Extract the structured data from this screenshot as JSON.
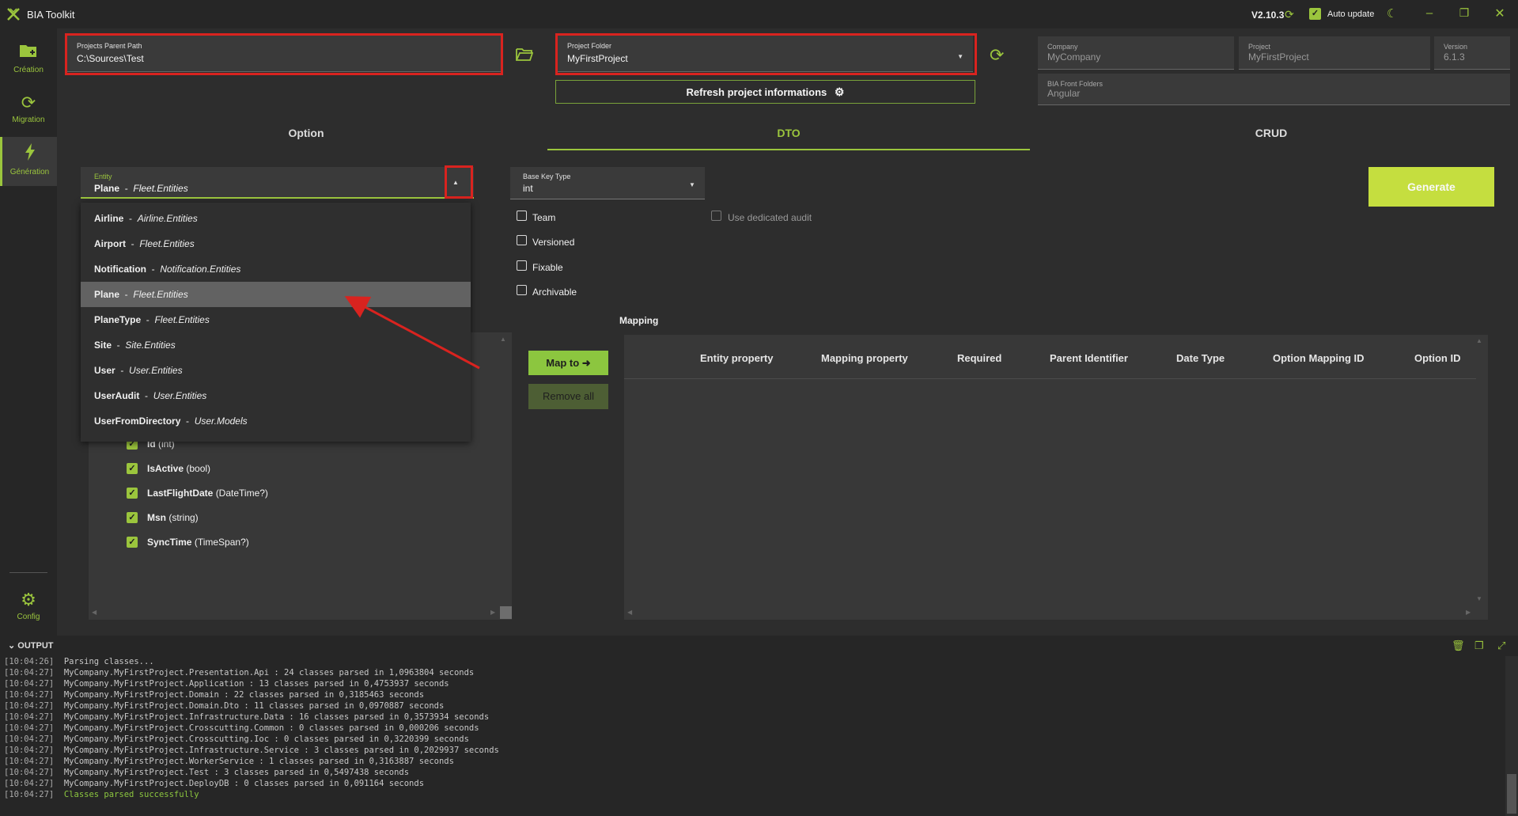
{
  "app": {
    "title": "BIA Toolkit",
    "version": "V2.10.3",
    "auto_update_label": "Auto update"
  },
  "sidebar": {
    "items": [
      {
        "label": "Création",
        "icon": "folder-plus-icon"
      },
      {
        "label": "Migration",
        "icon": "sync-icon"
      },
      {
        "label": "Génération",
        "icon": "lightning-icon"
      }
    ],
    "config_label": "Config"
  },
  "top": {
    "parent_path": {
      "label": "Projects Parent Path",
      "value": "C:\\Sources\\Test"
    },
    "project_folder": {
      "label": "Project Folder",
      "value": "MyFirstProject"
    },
    "refresh_label": "Refresh project informations",
    "company": {
      "label": "Company",
      "value": "MyCompany"
    },
    "project": {
      "label": "Project",
      "value": "MyFirstProject"
    },
    "version": {
      "label": "Version",
      "value": "6.1.3"
    },
    "front_folders": {
      "label": "BIA Front Folders",
      "value": "Angular"
    }
  },
  "tabs": [
    "Option",
    "DTO",
    "CRUD"
  ],
  "active_tab": "DTO",
  "entity": {
    "label": "Entity",
    "selected_name": "Plane",
    "selected_ns": "Fleet.Entities",
    "options": [
      {
        "name": "Airline",
        "ns": "Airline.Entities"
      },
      {
        "name": "Airport",
        "ns": "Fleet.Entities"
      },
      {
        "name": "Notification",
        "ns": "Notification.Entities"
      },
      {
        "name": "Plane",
        "ns": "Fleet.Entities"
      },
      {
        "name": "PlaneType",
        "ns": "Fleet.Entities"
      },
      {
        "name": "Site",
        "ns": "Site.Entities"
      },
      {
        "name": "User",
        "ns": "User.Entities"
      },
      {
        "name": "UserAudit",
        "ns": "User.Entities"
      },
      {
        "name": "UserFromDirectory",
        "ns": "User.Models"
      }
    ],
    "separator": "-"
  },
  "base_key": {
    "label": "Base Key Type",
    "value": "int"
  },
  "options": {
    "team": "Team",
    "versioned": "Versioned",
    "fixable": "Fixable",
    "archivable": "Archivable",
    "dedicated_audit": "Use dedicated audit"
  },
  "generate_label": "Generate",
  "properties": [
    {
      "name": "Id",
      "type": "(int)"
    },
    {
      "name": "IsActive",
      "type": "(bool)"
    },
    {
      "name": "LastFlightDate",
      "type": "(DateTime?)"
    },
    {
      "name": "Msn",
      "type": "(string)"
    },
    {
      "name": "SyncTime",
      "type": "(TimeSpan?)"
    }
  ],
  "map_to_label": "Map to ➜",
  "remove_all_label": "Remove all",
  "mapping": {
    "title": "Mapping",
    "columns": [
      "Entity property",
      "Mapping property",
      "Required",
      "Parent Identifier",
      "Date Type",
      "Option Mapping ID",
      "Option ID"
    ]
  },
  "output": {
    "title": "OUTPUT",
    "lines": [
      {
        "ts": "[10:04:26]",
        "msg": "Parsing classes..."
      },
      {
        "ts": "[10:04:27]",
        "msg": "MyCompany.MyFirstProject.Presentation.Api : 24 classes parsed in 1,0963804 seconds"
      },
      {
        "ts": "[10:04:27]",
        "msg": "MyCompany.MyFirstProject.Application : 13 classes parsed in 0,4753937 seconds"
      },
      {
        "ts": "[10:04:27]",
        "msg": "MyCompany.MyFirstProject.Domain : 22 classes parsed in 0,3185463 seconds"
      },
      {
        "ts": "[10:04:27]",
        "msg": "MyCompany.MyFirstProject.Domain.Dto : 11 classes parsed in 0,0970887 seconds"
      },
      {
        "ts": "[10:04:27]",
        "msg": "MyCompany.MyFirstProject.Infrastructure.Data : 16 classes parsed in 0,3573934 seconds"
      },
      {
        "ts": "[10:04:27]",
        "msg": "MyCompany.MyFirstProject.Crosscutting.Common : 0 classes parsed in 0,000206 seconds"
      },
      {
        "ts": "[10:04:27]",
        "msg": "MyCompany.MyFirstProject.Crosscutting.Ioc : 0 classes parsed in 0,3220399 seconds"
      },
      {
        "ts": "[10:04:27]",
        "msg": "MyCompany.MyFirstProject.Infrastructure.Service : 3 classes parsed in 0,2029937 seconds"
      },
      {
        "ts": "[10:04:27]",
        "msg": "MyCompany.MyFirstProject.WorkerService : 1 classes parsed in 0,3163887 seconds"
      },
      {
        "ts": "[10:04:27]",
        "msg": "MyCompany.MyFirstProject.Test : 3 classes parsed in 0,5497438 seconds"
      },
      {
        "ts": "[10:04:27]",
        "msg": "MyCompany.MyFirstProject.DeployDB : 0 classes parsed in 0,091164 seconds"
      },
      {
        "ts": "[10:04:27]",
        "msg": "Classes parsed successfully",
        "success": true
      }
    ]
  },
  "colors": {
    "accent": "#9bc53d",
    "highlight": "#d9231f",
    "generate": "#c5de3f"
  }
}
